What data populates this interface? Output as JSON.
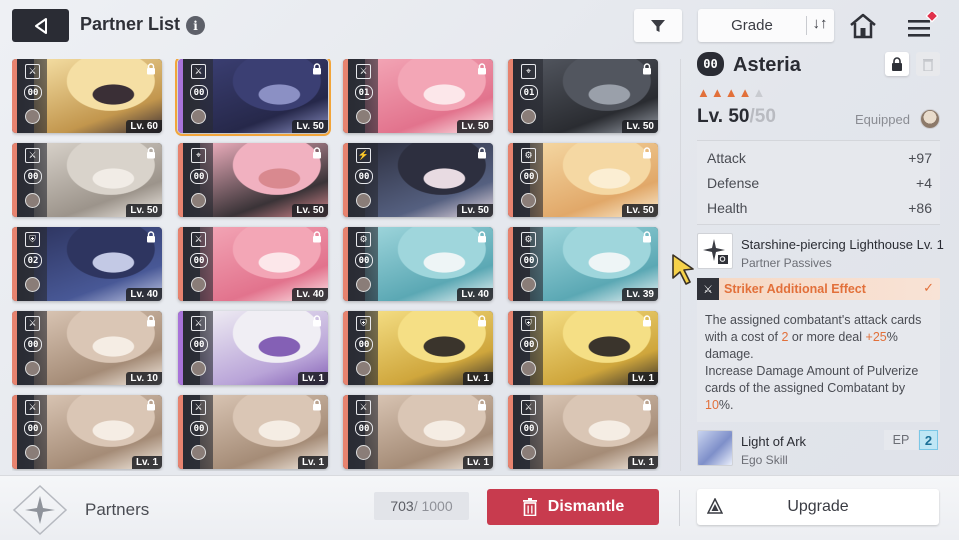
{
  "header": {
    "title": "Partner List",
    "info_icon": "i",
    "grade_label": "Grade",
    "sort_icon": "↓↑"
  },
  "grid": {
    "cards": [
      {
        "class_icon": "⚔",
        "rank": "00",
        "level": "Lv. 60",
        "stripe": "#e7836f",
        "art": [
          "#f5dfa4",
          "#c2964d",
          "#3a2f36"
        ],
        "selected": false
      },
      {
        "class_icon": "⚔",
        "rank": "00",
        "level": "Lv. 50",
        "stripe": "#a873d9",
        "art": [
          "#3b3f73",
          "#26284a",
          "#8b90c4"
        ],
        "selected": true
      },
      {
        "class_icon": "⚔",
        "rank": "01",
        "level": "Lv. 50",
        "stripe": "#e7836f",
        "art": [
          "#f3a6b6",
          "#e2738d",
          "#fce7ea"
        ],
        "selected": false
      },
      {
        "class_icon": "⌖",
        "rank": "01",
        "level": "Lv. 50",
        "stripe": "#e7836f",
        "art": [
          "#52565f",
          "#2a2c31",
          "#9aa0aa"
        ],
        "selected": false
      },
      {
        "class_icon": "⚔",
        "rank": "00",
        "level": "Lv. 50",
        "stripe": "#e7836f",
        "art": [
          "#d9d3cb",
          "#9c948b",
          "#f1ece6"
        ],
        "selected": false
      },
      {
        "class_icon": "⌖",
        "rank": "00",
        "level": "Lv. 50",
        "stripe": "#e7836f",
        "art": [
          "#f1b1c0",
          "#3a3337",
          "#d9898f"
        ],
        "selected": false
      },
      {
        "class_icon": "⚡",
        "rank": "00",
        "level": "Lv. 50",
        "stripe": "#e7836f",
        "art": [
          "#2d2f3f",
          "#556080",
          "#e8dbe2"
        ],
        "selected": false
      },
      {
        "class_icon": "⚙",
        "rank": "00",
        "level": "Lv. 50",
        "stripe": "#e7836f",
        "art": [
          "#f5d8a3",
          "#e1a869",
          "#fbeed3"
        ],
        "selected": false
      },
      {
        "class_icon": "⛨",
        "rank": "02",
        "level": "Lv. 40",
        "stripe": "#e7836f",
        "art": [
          "#2e3560",
          "#485896",
          "#c3c9e5"
        ],
        "selected": false
      },
      {
        "class_icon": "⚔",
        "rank": "00",
        "level": "Lv. 40",
        "stripe": "#e7836f",
        "art": [
          "#f3a6b6",
          "#e2738d",
          "#fce7ea"
        ],
        "selected": false
      },
      {
        "class_icon": "⚙",
        "rank": "00",
        "level": "Lv. 40",
        "stripe": "#e7836f",
        "art": [
          "#9fd6dc",
          "#5ba8b4",
          "#eef5f6"
        ],
        "selected": false
      },
      {
        "class_icon": "⚙",
        "rank": "00",
        "level": "Lv. 39",
        "stripe": "#e7836f",
        "art": [
          "#9fd6dc",
          "#5ba8b4",
          "#eef5f6"
        ],
        "selected": false
      },
      {
        "class_icon": "⚔",
        "rank": "00",
        "level": "Lv. 10",
        "stripe": "#e7836f",
        "art": [
          "#dac6b5",
          "#a58c77",
          "#f5ede4"
        ],
        "selected": false
      },
      {
        "class_icon": "⚔",
        "rank": "00",
        "level": "Lv. 1",
        "stripe": "#a873d9",
        "art": [
          "#f0eef4",
          "#b9a4d8",
          "#8460b5"
        ],
        "selected": false
      },
      {
        "class_icon": "⛨",
        "rank": "00",
        "level": "Lv. 1",
        "stripe": "#e7836f",
        "art": [
          "#f5df85",
          "#cfa63c",
          "#3a342c"
        ],
        "selected": false
      },
      {
        "class_icon": "⛨",
        "rank": "00",
        "level": "Lv. 1",
        "stripe": "#e7836f",
        "art": [
          "#f5df85",
          "#cfa63c",
          "#3a342c"
        ],
        "selected": false
      },
      {
        "class_icon": "⚔",
        "rank": "00",
        "level": "Lv. 1",
        "stripe": "#e7836f",
        "art": [
          "#dac6b5",
          "#a58c77",
          "#f5ede4"
        ],
        "selected": false
      },
      {
        "class_icon": "⚔",
        "rank": "00",
        "level": "Lv. 1",
        "stripe": "#e7836f",
        "art": [
          "#dac6b5",
          "#a58c77",
          "#f5ede4"
        ],
        "selected": false
      },
      {
        "class_icon": "⚔",
        "rank": "00",
        "level": "Lv. 1",
        "stripe": "#e7836f",
        "art": [
          "#dac6b5",
          "#a58c77",
          "#f5ede4"
        ],
        "selected": false
      },
      {
        "class_icon": "⚔",
        "rank": "00",
        "level": "Lv. 1",
        "stripe": "#e7836f",
        "art": [
          "#dac6b5",
          "#a58c77",
          "#f5ede4"
        ],
        "selected": false
      }
    ]
  },
  "detail": {
    "rank": "00",
    "name": "Asteria",
    "stars_filled": 4,
    "stars_total": 5,
    "level": "Lv. 50",
    "level_max": "/50",
    "equipped_label": "Equipped",
    "stats": [
      {
        "label": "Attack",
        "value": "+97"
      },
      {
        "label": "Defense",
        "value": "+4"
      },
      {
        "label": "Health",
        "value": "+86"
      }
    ],
    "passive": {
      "name": "Starshine-piercing Lighthouse Lv. 1",
      "type": "Partner Passives"
    },
    "effect": {
      "label": "Striker Additional Effect",
      "check": "✓"
    },
    "description": {
      "p1_a": "The assigned combatant's attack cards with a cost of ",
      "p1_hl1": "2",
      "p1_b": " or more deal ",
      "p1_hl2": "+25",
      "p1_c": "% damage.",
      "p2_a": "Increase Damage Amount of Pulverize cards of the assigned Combatant by ",
      "p2_hl": "10",
      "p2_b": "%."
    },
    "ego_skill": {
      "name": "Light of Ark",
      "type": "Ego Skill",
      "ep_label": "EP",
      "ep_value": "2"
    }
  },
  "footer": {
    "partners_label": "Partners",
    "count": "703",
    "count_max": " / 1000",
    "dismantle_label": "Dismantle",
    "upgrade_label": "Upgrade"
  },
  "colors": {
    "accent_orange": "#e2703a",
    "dismantle_red": "#c83b4e",
    "selected_outline": "#f2a53a"
  }
}
